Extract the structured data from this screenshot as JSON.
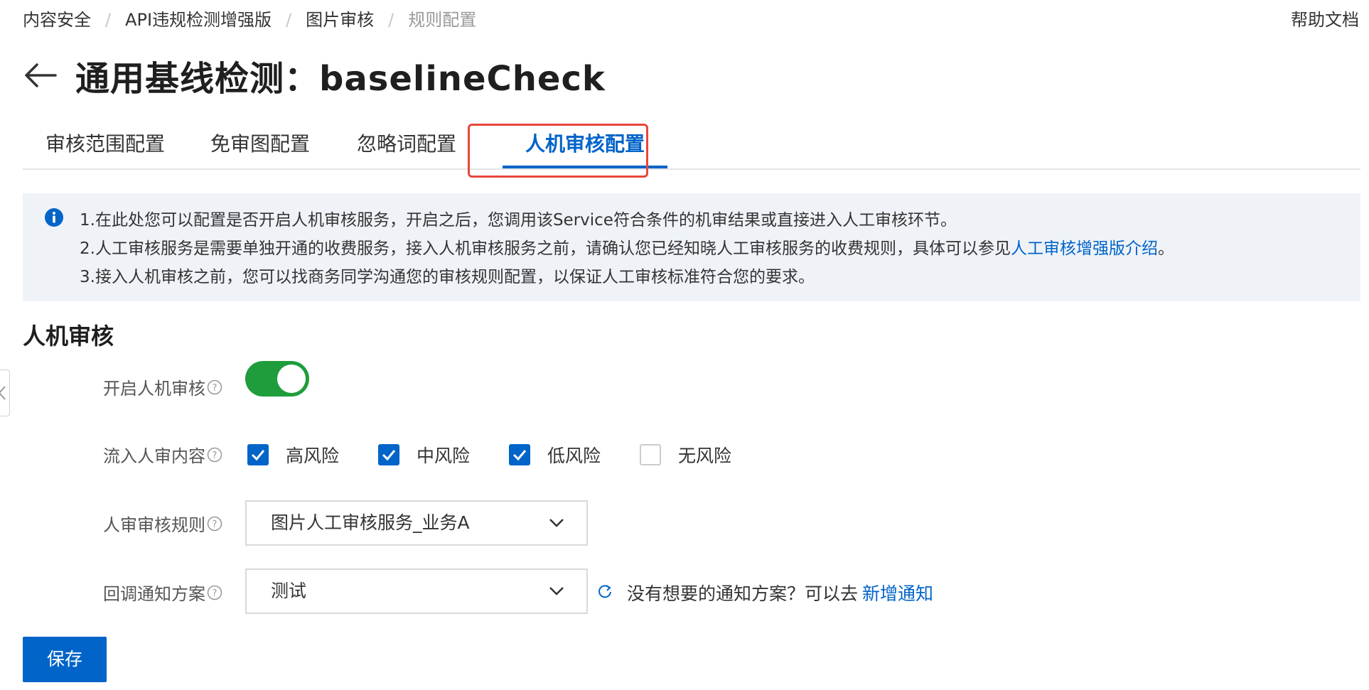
{
  "breadcrumb": {
    "items": [
      "内容安全",
      "API违规检测增强版",
      "图片审核",
      "规则配置"
    ],
    "separator": "/"
  },
  "help_link": "帮助文档",
  "title": "通用基线检测：baselineCheck",
  "tabs": [
    "审核范围配置",
    "免审图配置",
    "忽略词配置",
    "人机审核配置"
  ],
  "active_tab": "人机审核配置",
  "notice": {
    "line1": "1.在此处您可以配置是否开启人机审核服务，开启之后，您调用该Service符合条件的机审结果或直接进入人工审核环节。",
    "line2_prefix": "2.人工审核服务是需要单独开通的收费服务，接入人机审核服务之前，请确认您已经知晓人工审核服务的收费规则，具体可以参见",
    "line2_link": "人工审核增强版介绍",
    "line2_suffix": "。",
    "line3": "3.接入人机审核之前，您可以找商务同学沟通您的审核规则配置，以保证人工审核标准符合您的要求。"
  },
  "section_title": "人机审核",
  "form": {
    "enable_label": "开启人机审核",
    "enable_on": true,
    "content_label": "流入人审内容",
    "risk_options": [
      {
        "label": "高风险",
        "checked": true
      },
      {
        "label": "中风险",
        "checked": true
      },
      {
        "label": "低风险",
        "checked": true
      },
      {
        "label": "无风险",
        "checked": false
      }
    ],
    "rule_label": "人审审核规则",
    "rule_value": "图片人工审核服务_业务A",
    "callback_label": "回调通知方案",
    "callback_value": "测试",
    "callback_hint": "没有想要的通知方案？可以去",
    "callback_link": "新增通知"
  },
  "save_button": "保存",
  "colors": {
    "primary": "#0064c8",
    "switch_on": "#1f9d3c",
    "highlight_border": "#e8463c",
    "notice_bg": "#eff3f8"
  }
}
